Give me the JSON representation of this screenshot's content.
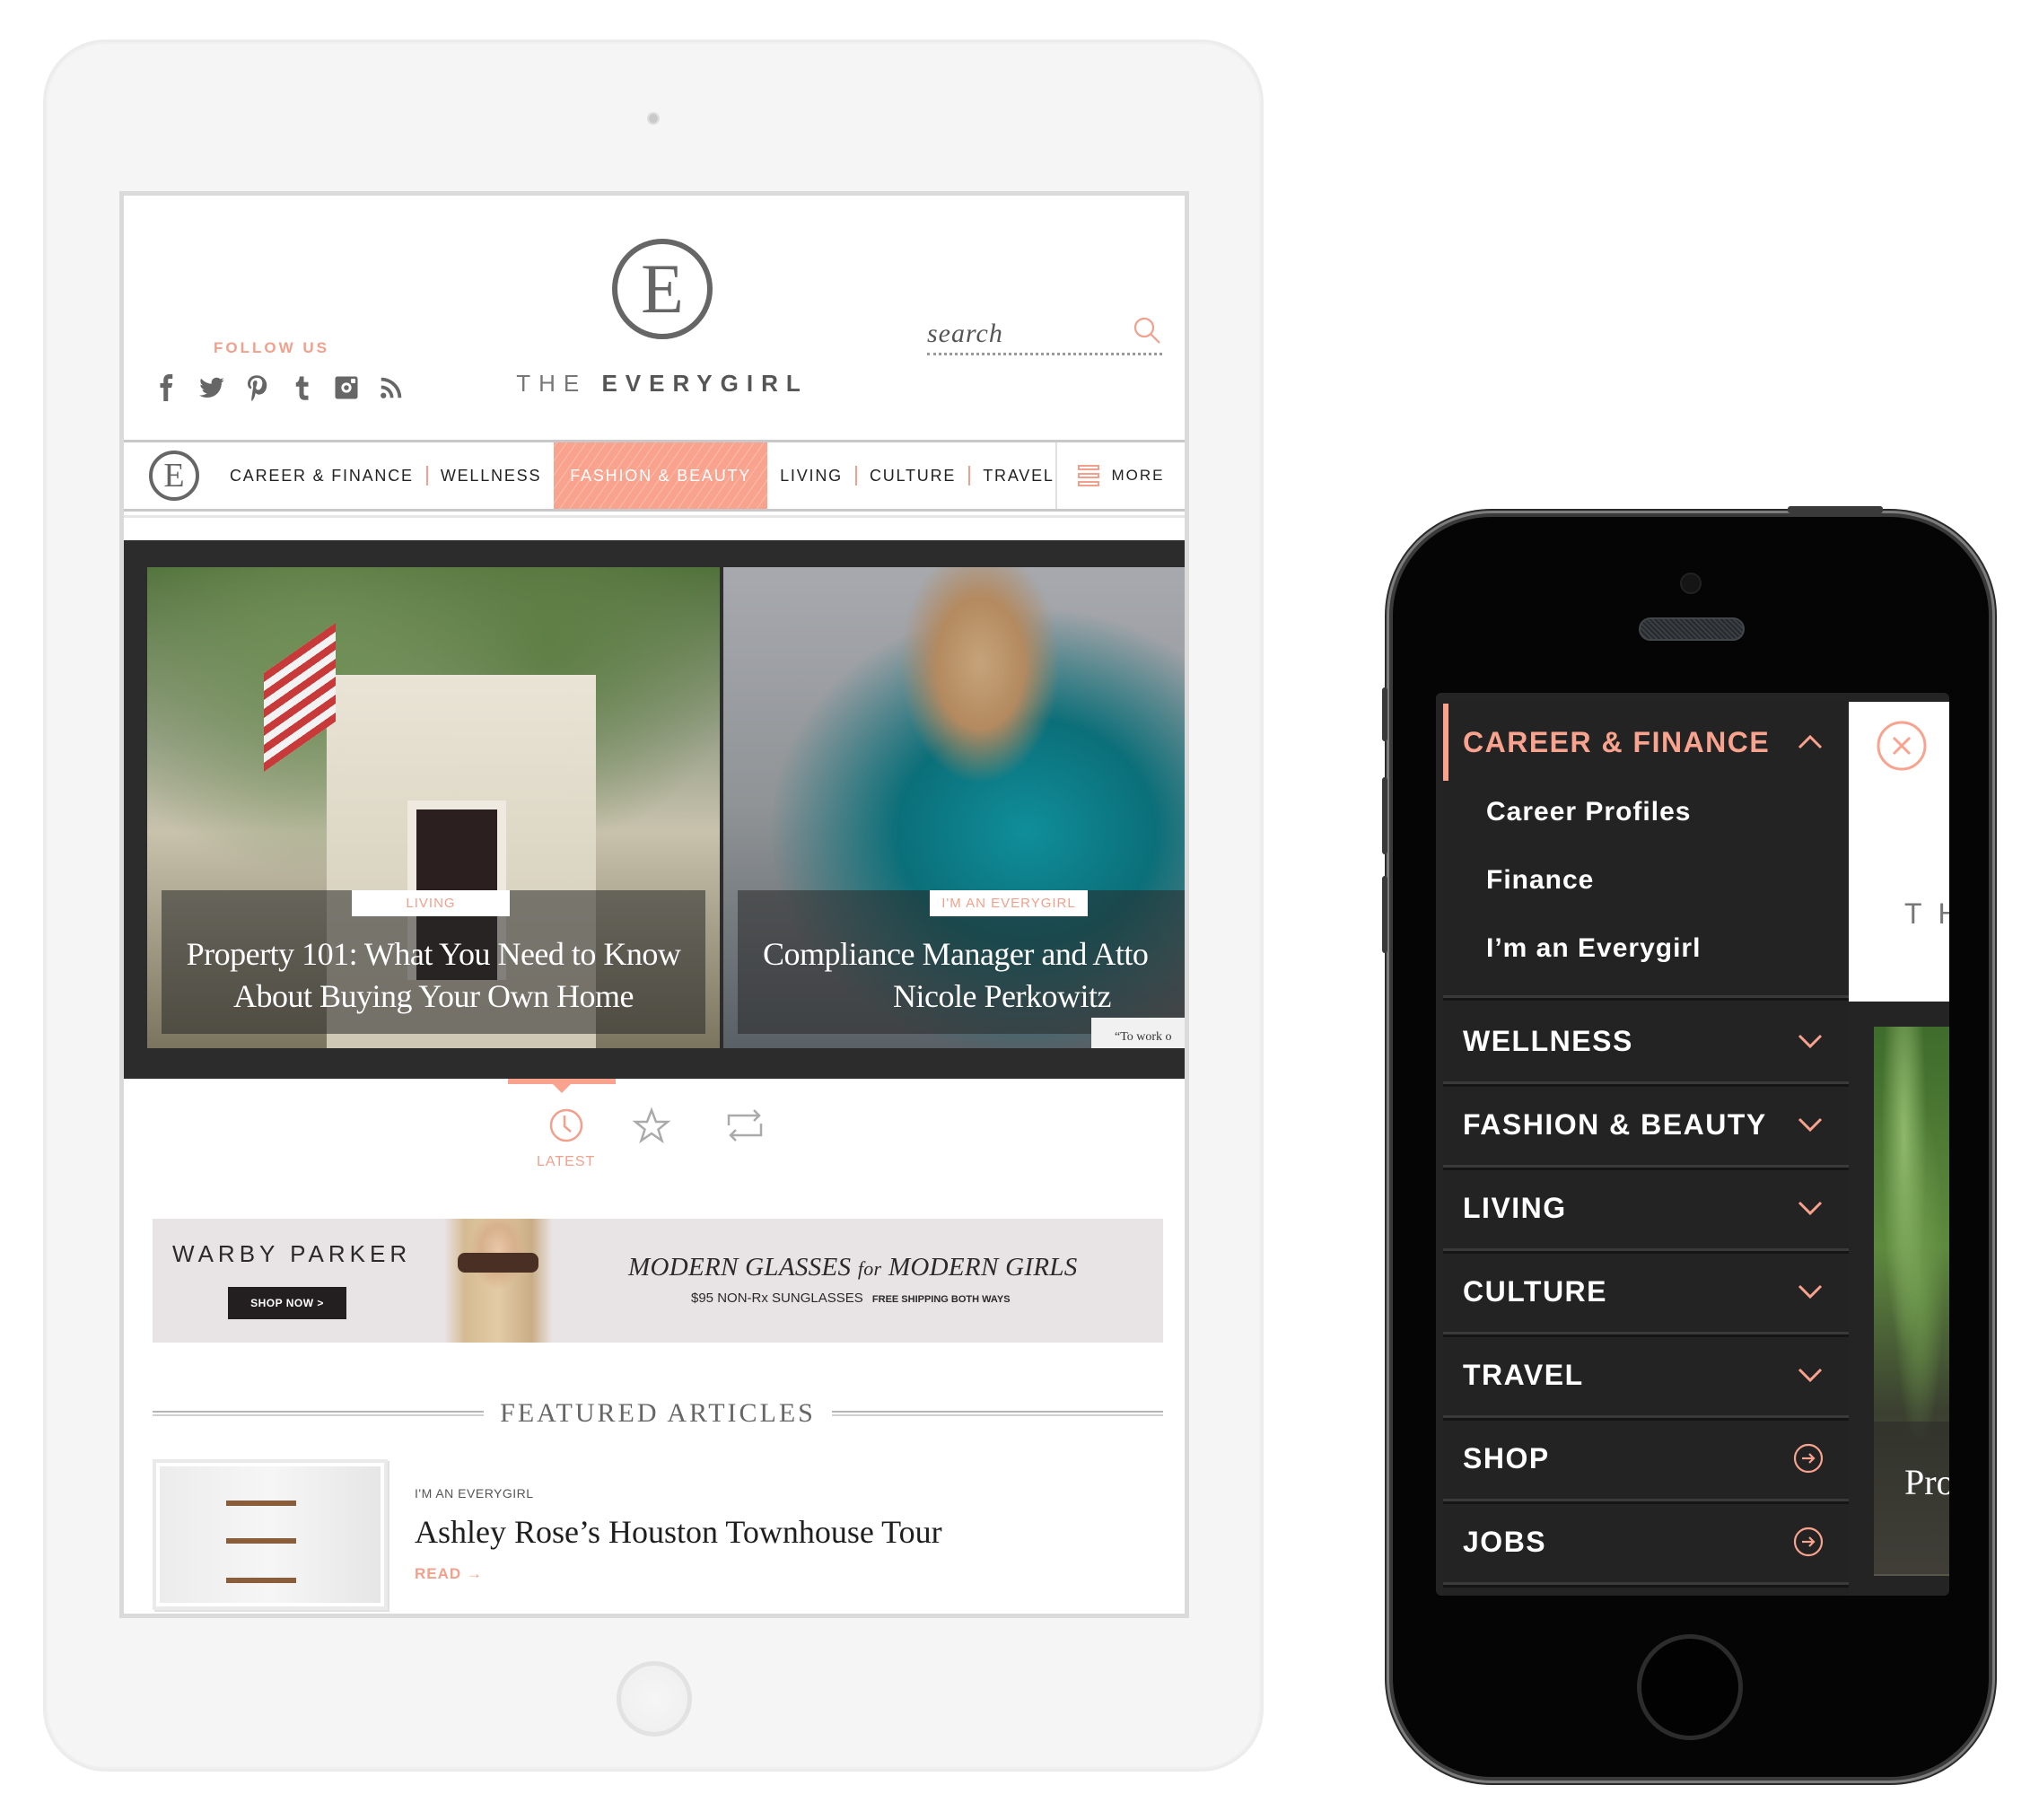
{
  "tablet": {
    "header": {
      "follow_label": "FOLLOW US",
      "social_icons": [
        "facebook-icon",
        "twitter-icon",
        "pinterest-icon",
        "tumblr-icon",
        "instagram-icon",
        "rss-icon"
      ],
      "logo_letter": "E",
      "logo_text_light": "THE",
      "logo_text_bold": "EVERYGIRL",
      "search_placeholder": "search"
    },
    "nav": {
      "logo_letter": "E",
      "items": [
        {
          "label": "CAREER & FINANCE",
          "active": false
        },
        {
          "label": "WELLNESS",
          "active": false
        },
        {
          "label": "FASHION & BEAUTY",
          "active": true
        },
        {
          "label": "LIVING",
          "active": false
        },
        {
          "label": "CULTURE",
          "active": false
        },
        {
          "label": "TRAVEL",
          "active": false
        }
      ],
      "more_label": "MORE"
    },
    "hero": {
      "slides": [
        {
          "tag": "LIVING",
          "title_line1": "Property 101: What You Need to Know",
          "title_line2": "About Buying Your Own Home"
        },
        {
          "tag": "I'M AN EVERYGIRL",
          "title_line1": "Compliance Manager and Atto",
          "title_line2": "Nicole Perkowitz",
          "quote_snippet": "“To work o"
        }
      ]
    },
    "tabs": [
      {
        "icon": "clock-icon",
        "label": "LATEST",
        "active": true
      },
      {
        "icon": "star-icon",
        "label": "",
        "active": false
      },
      {
        "icon": "repeat-icon",
        "label": "",
        "active": false
      }
    ],
    "ad": {
      "brand": "WARBY PARKER",
      "cta": "SHOP NOW >",
      "headline_a": "MODERN GLASSES",
      "headline_for": "for",
      "headline_b": "MODERN GIRLS",
      "sub_main": "$95 NON-Rx SUNGLASSES",
      "sub_small": "FREE SHIPPING BOTH WAYS"
    },
    "featured": {
      "heading": "FEATURED ARTICLES",
      "articles": [
        {
          "category": "I'M AN EVERYGIRL",
          "title": "Ashley Rose’s Houston Townhouse Tour",
          "read_label": "READ →"
        }
      ]
    }
  },
  "phone": {
    "menu": {
      "expanded": {
        "label": "CAREER & FINANCE",
        "subitems": [
          "Career Profiles",
          "Finance",
          "I’m an Everygirl"
        ]
      },
      "items": [
        {
          "label": "WELLNESS",
          "icon": "chevron-down-icon"
        },
        {
          "label": "FASHION & BEAUTY",
          "icon": "chevron-down-icon"
        },
        {
          "label": "LIVING",
          "icon": "chevron-down-icon"
        },
        {
          "label": "CULTURE",
          "icon": "chevron-down-icon"
        },
        {
          "label": "TRAVEL",
          "icon": "chevron-down-icon"
        },
        {
          "label": "SHOP",
          "icon": "arrow-circle-icon"
        },
        {
          "label": "JOBS",
          "icon": "arrow-circle-icon"
        }
      ]
    },
    "peek": {
      "logo_fragment": "TH",
      "title_fragment": "Pro"
    }
  },
  "colors": {
    "accent": "#f9a38e",
    "accent_text": "#f2a08c",
    "menu_bg": "#232323",
    "text_dark": "#222222"
  }
}
